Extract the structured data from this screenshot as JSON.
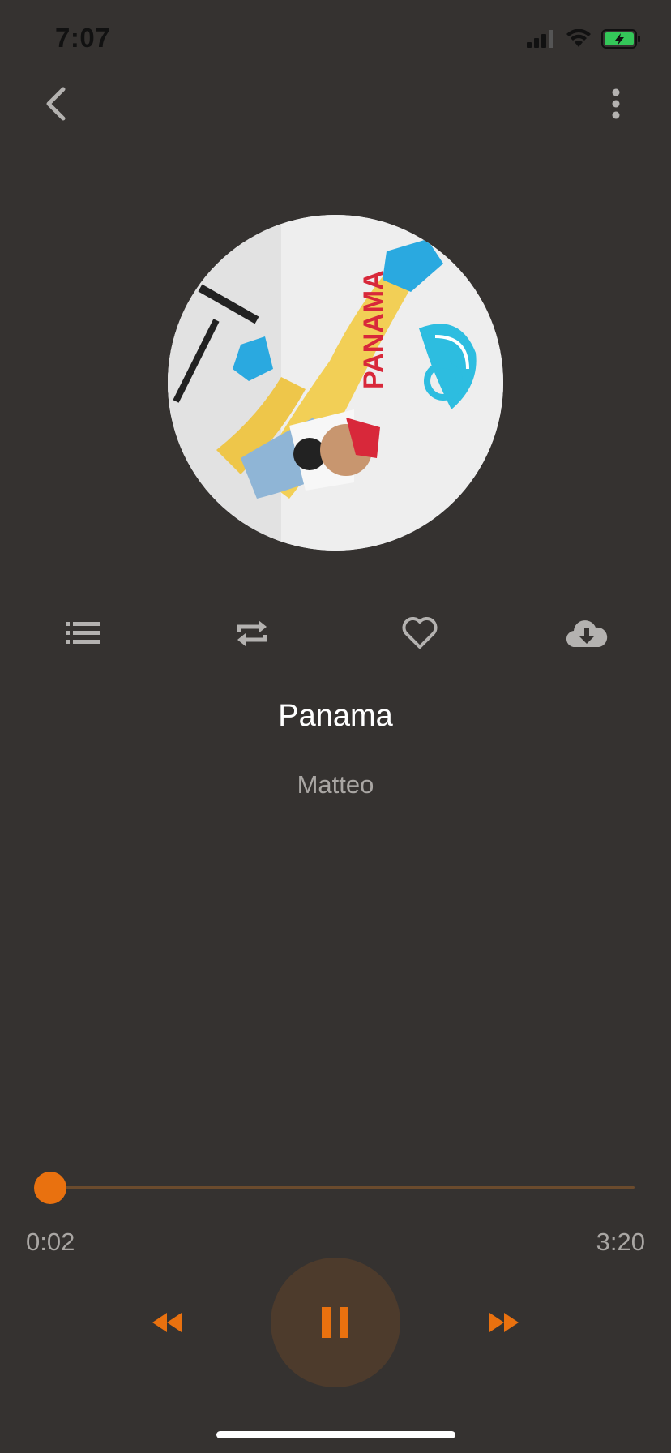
{
  "status_bar": {
    "time": "7:07",
    "icons": [
      "signal-icon",
      "wifi-icon",
      "battery-charging-icon"
    ]
  },
  "nav": {
    "back_icon": "chevron-left-icon",
    "more_icon": "more-vertical-icon"
  },
  "album": {
    "art_text": "PANAMA"
  },
  "actions": [
    {
      "name": "queue-list-button",
      "icon": "list-icon"
    },
    {
      "name": "repeat-button",
      "icon": "repeat-icon"
    },
    {
      "name": "favorite-button",
      "icon": "heart-icon"
    },
    {
      "name": "download-button",
      "icon": "cloud-download-icon"
    }
  ],
  "track": {
    "title": "Panama",
    "artist": "Matteo"
  },
  "playback": {
    "elapsed": "0:02",
    "duration": "3:20",
    "progress_fraction": 0.01,
    "state": "playing"
  },
  "colors": {
    "background": "#353230",
    "accent": "#e9710f",
    "muted_text": "#a9a6a3",
    "icon_gray": "#b4b2b0"
  }
}
